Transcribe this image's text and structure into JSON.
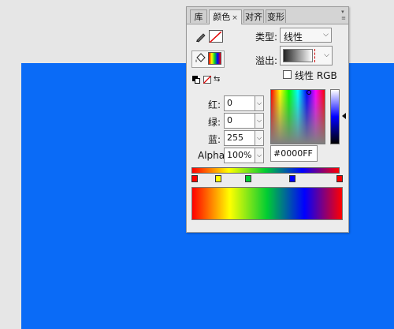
{
  "tabs": [
    {
      "label": "库",
      "active": false
    },
    {
      "label": "颜色",
      "active": true
    },
    {
      "label": "对齐",
      "active": false
    },
    {
      "label": "变形",
      "active": false
    }
  ],
  "close_glyph": "×",
  "type": {
    "label": "类型:",
    "value": "线性"
  },
  "overflow": {
    "label": "溢出:"
  },
  "linear_rgb": {
    "label": "线性 RGB",
    "checked": false
  },
  "rgb": {
    "red": {
      "label": "红:",
      "value": "0"
    },
    "green": {
      "label": "绿:",
      "value": "0"
    },
    "blue": {
      "label": "蓝:",
      "value": "255"
    }
  },
  "alpha": {
    "label": "Alpha:",
    "value": "100%"
  },
  "hex": "#0000FF",
  "gradient_stops": [
    {
      "color": "#ff0000"
    },
    {
      "color": "#ffff00"
    },
    {
      "color": "#00cc33"
    },
    {
      "color": "#0000ff"
    },
    {
      "color": "#ff0000"
    }
  ],
  "colors": {
    "canvas": "#0a6bf7",
    "selected": "#0000ff"
  },
  "icons": [
    "stroke-pencil-icon",
    "no-color-swatch-icon",
    "fill-bucket-icon",
    "gradient-swatch-icon",
    "default-colors-icon",
    "no-color-icon",
    "swap-colors-icon",
    "panel-menu-icon"
  ]
}
